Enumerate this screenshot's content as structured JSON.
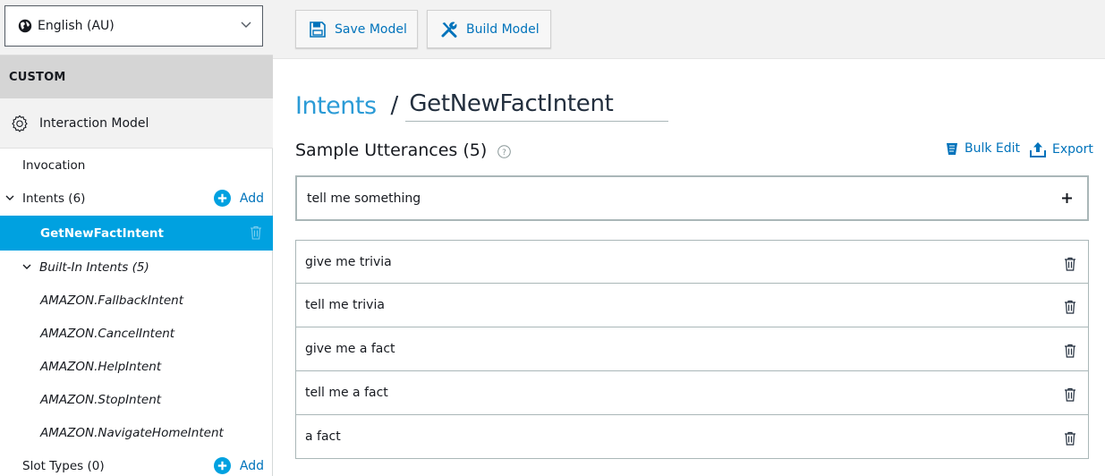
{
  "sidebar": {
    "locale": "English (AU)",
    "section_header": "CUSTOM",
    "interaction_model": "Interaction Model",
    "invocation": "Invocation",
    "intents_label": "Intents (6)",
    "add_label": "Add",
    "selected_intent": "GetNewFactIntent",
    "builtin_label": "Built-In Intents (5)",
    "builtin_items": [
      "AMAZON.FallbackIntent",
      "AMAZON.CancelIntent",
      "AMAZON.HelpIntent",
      "AMAZON.StopIntent",
      "AMAZON.NavigateHomeIntent"
    ],
    "slot_types_label": "Slot Types (0)",
    "slot_add_label": "Add"
  },
  "toolbar": {
    "save_label": "Save Model",
    "build_label": "Build Model"
  },
  "main": {
    "breadcrumb_root": "Intents",
    "breadcrumb_sep": "/",
    "intent_name": "GetNewFactIntent",
    "section_title": "Sample Utterances (5)",
    "bulk_edit": "Bulk Edit",
    "export": "Export",
    "input_value": "tell me something",
    "utterances": [
      "give me trivia",
      "tell me trivia",
      "give me a fact",
      "tell me a fact",
      "a fact"
    ]
  },
  "colors": {
    "accent": "#00a1e0",
    "link": "#0073bb"
  }
}
